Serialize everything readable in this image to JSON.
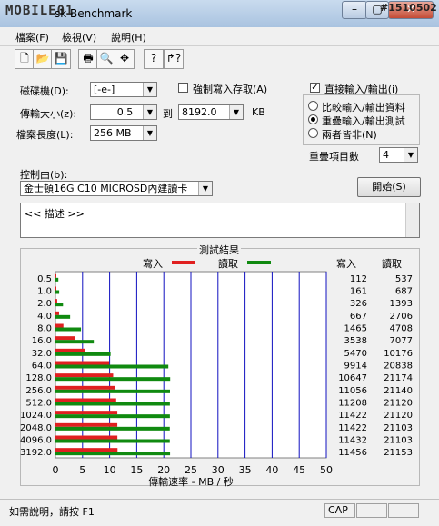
{
  "window": {
    "title": "sk Benchmark",
    "watermark_logo": "MOBILE01",
    "watermark_id": "#1510502",
    "controls": {
      "minimize": "–",
      "maximize": "▢",
      "close": "✕"
    }
  },
  "menu": [
    "檔案(F)",
    "檢視(V)",
    "說明(H)"
  ],
  "toolbar": [
    "new-icon",
    "open-icon",
    "save-icon",
    "print-icon",
    "print-preview-icon",
    "move-icon",
    "help-icon",
    "context-help-icon"
  ],
  "settings": {
    "drive_label": "磁碟機(D):",
    "drive_value": "[-e-]",
    "force_write_label": "強制寫入存取(A)",
    "force_write_checked": false,
    "transfer_size_label": "傳輸大小(z):",
    "transfer_from": "0.5",
    "to_label": "到",
    "transfer_to": "8192.0",
    "unit": "KB",
    "file_length_label": "檔案長度(L):",
    "file_length": "256 MB",
    "direct_io_label": "直接輸入/輸出(i)",
    "direct_io_checked": true,
    "radio_options": [
      "比較輸入/輸出資料",
      "重疊輸入/輸出測試",
      "兩者皆非(N)"
    ],
    "radio_selected": 1,
    "queue_label": "重疊項目數",
    "queue_value": "4",
    "controlled_by_label": "控制由(b):",
    "controlled_by_value": "金士頓16G C10 MICROSD內建讀卡",
    "start_button": "開始(S)",
    "description_text": "<<   描述   >>"
  },
  "results": {
    "group_title": "測試結果",
    "write_legend": "寫入",
    "read_legend": "讀取",
    "write_col": "寫入",
    "read_col": "讀取"
  },
  "chart_data": {
    "type": "bar",
    "orientation": "horizontal",
    "categories": [
      "0.5",
      "1.0",
      "2.0",
      "4.0",
      "8.0",
      "16.0",
      "32.0",
      "64.0",
      "128.0",
      "256.0",
      "512.0",
      "1024.0",
      "2048.0",
      "4096.0",
      "3192.0"
    ],
    "series": [
      {
        "name": "寫入",
        "color": "#e02020",
        "values": [
          112,
          161,
          326,
          667,
          1465,
          3538,
          5470,
          9914,
          10647,
          11056,
          11208,
          11422,
          11422,
          11432,
          11456
        ]
      },
      {
        "name": "讀取",
        "color": "#108a10",
        "values": [
          537,
          687,
          1393,
          2706,
          4708,
          7077,
          10176,
          20838,
          21174,
          21140,
          21120,
          21120,
          21103,
          21103,
          21153
        ]
      }
    ],
    "xlabel": "傳輸速率 - MB / 秒",
    "xlim": [
      0,
      50
    ],
    "xticks": [
      0,
      5,
      10,
      15,
      20,
      25,
      30,
      35,
      40,
      45,
      50
    ],
    "grid": true
  },
  "status": {
    "help_text": "如需說明，請按 F1",
    "caps": "CAP"
  }
}
